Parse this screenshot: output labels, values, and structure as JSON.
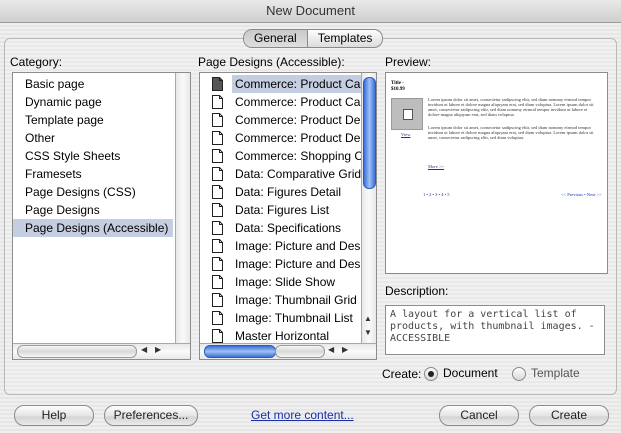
{
  "window": {
    "title": "New Document"
  },
  "tabs": [
    {
      "label": "General",
      "selected": true
    },
    {
      "label": "Templates",
      "selected": false
    }
  ],
  "category": {
    "label": "Category:",
    "items": [
      "Basic page",
      "Dynamic page",
      "Template page",
      "Other",
      "CSS Style Sheets",
      "Framesets",
      "Page Designs (CSS)",
      "Page Designs",
      "Page Designs (Accessible)"
    ],
    "selected_index": 8
  },
  "designs": {
    "label": "Page Designs (Accessible):",
    "items": [
      "Commerce: Product Ca",
      "Commerce: Product Ca",
      "Commerce: Product De",
      "Commerce: Product De",
      "Commerce: Shopping C",
      "Data: Comparative Grid",
      "Data: Figures Detail",
      "Data: Figures List",
      "Data: Specifications",
      "Image: Picture and Des",
      "Image: Picture and Des",
      "Image: Slide Show",
      "Image: Thumbnail Grid",
      "Image: Thumbnail List",
      "Master Horizontal"
    ],
    "selected_index": 0
  },
  "preview": {
    "label": "Preview:",
    "title_text": "Title -",
    "price": "$10.99",
    "view_link": "View",
    "more_link": "More >>",
    "body_text": "Lorem ipsum dolor sit amet, consectetur sadipscing elitr, sed diam nonumy eirmod tempor invidunt ut labore et dolore magna aliquyam erat, sed diam voluptua. Lorem ipsum dolor sit amet, consectetur sadipscing elitr, sed diam nonumy eirmod tempor invidunt ut labore et dolore magna aliquyam erat, sed diam voluptua.",
    "body_text_2": "Lorem ipsum dolor sit amet, consectetur sadipscing elitr, sed diam nonumy eirmod tempor invidunt ut labore et dolore magna aliquyam erat, sed diam voluptua. Lorem ipsum dolor sit amet, consectetur sadipscing elitr, sed diam voluptua.",
    "pager": "1 • 2 • 3 • 4 • 5",
    "prev_next": "<< Previous • Next >>"
  },
  "description": {
    "label": "Description:",
    "text": "A layout for a vertical list of products, with thumbnail images. - ACCESSIBLE"
  },
  "create": {
    "label": "Create:",
    "options": [
      {
        "label": "Document",
        "selected": true
      },
      {
        "label": "Template",
        "selected": false
      }
    ]
  },
  "buttons": {
    "help": "Help",
    "preferences": "Preferences...",
    "get_more": "Get more content...",
    "cancel": "Cancel",
    "create": "Create"
  }
}
